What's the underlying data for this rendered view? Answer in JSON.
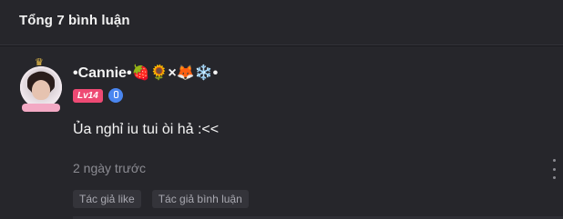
{
  "header": {
    "title": "Tổng 7 bình luận"
  },
  "comment": {
    "avatar_icon": "avatar-photo",
    "avatar_crown": "♛",
    "username": "•Cannie•🍓🌻×🦊❄️•",
    "level": "Lv14",
    "verified_icon": "verified-mic-icon",
    "text": "Ủa nghỉ iu tui òi hả :<<",
    "timestamp": "2 ngày trước",
    "tags": [
      "Tác giả like",
      "Tác giả bình luận"
    ],
    "colors": {
      "level_badge": "#ee4a74",
      "verified": "#4a86f0"
    }
  }
}
